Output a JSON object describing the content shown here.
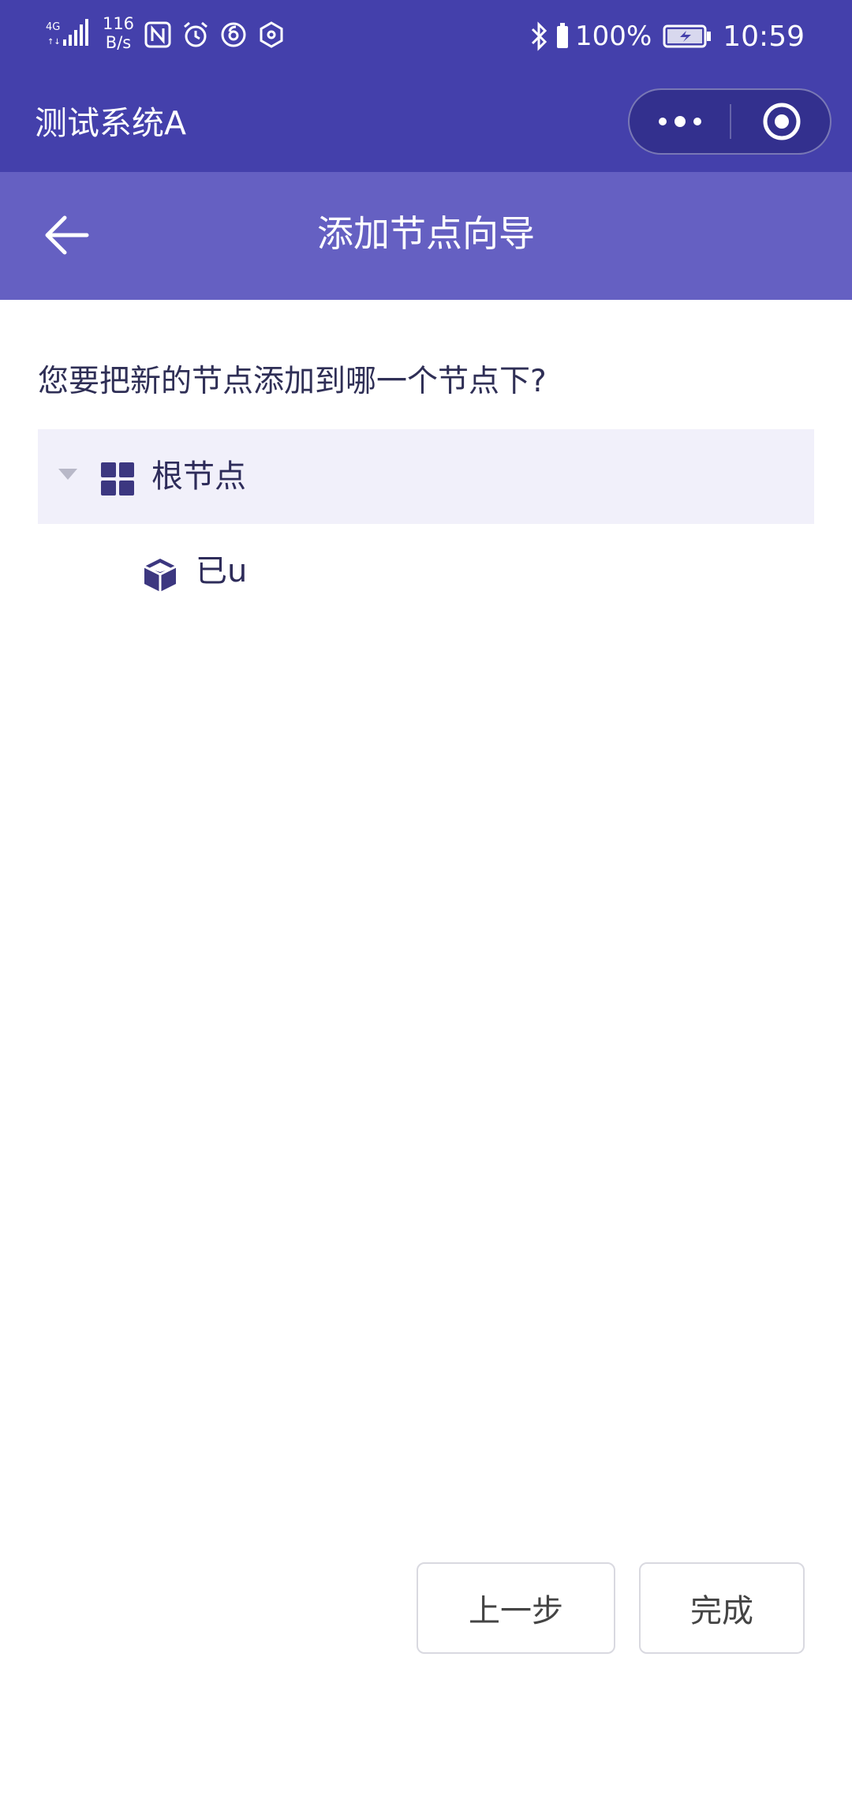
{
  "status_bar": {
    "network": "4G",
    "speed_value": "116",
    "speed_unit": "B/s",
    "battery_percent": "100%",
    "time": "10:59"
  },
  "app": {
    "title": "测试系统A"
  },
  "page": {
    "title": "添加节点向导",
    "question": "您要把新的节点添加到哪一个节点下?"
  },
  "tree": {
    "root_label": "根节点",
    "children": [
      {
        "label": "已u"
      }
    ]
  },
  "buttons": {
    "prev_label": "上一步",
    "done_label": "完成"
  },
  "colors": {
    "titlebar": "#4440ab",
    "header": "#6560c2",
    "tree_selected_bg": "#f1f0fa",
    "icon": "#3c3780"
  }
}
